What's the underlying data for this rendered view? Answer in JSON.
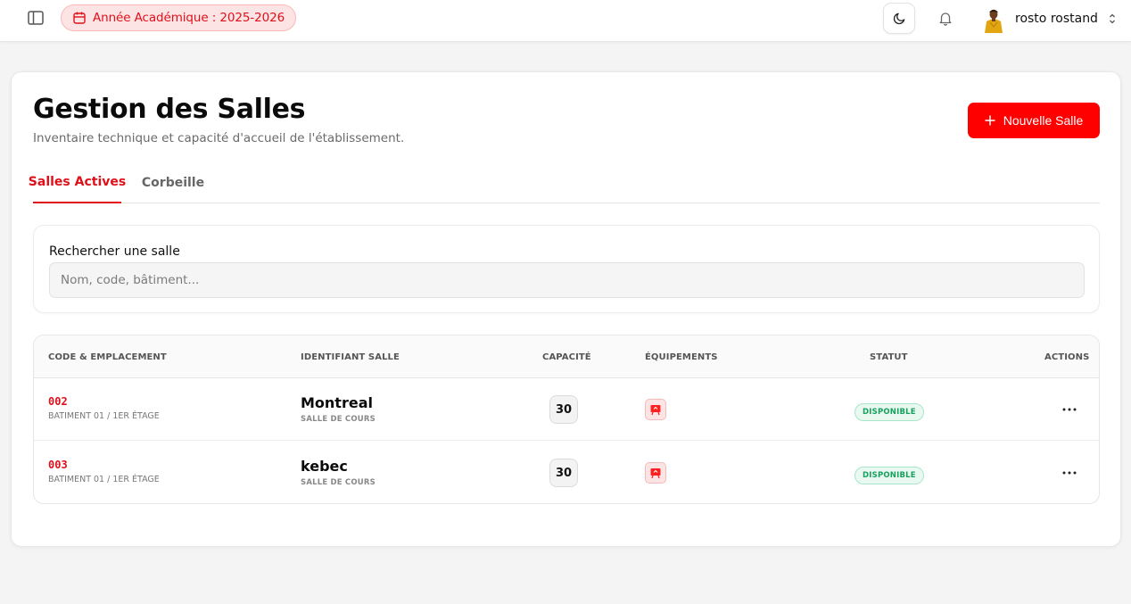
{
  "header": {
    "academic_year": "Année Académique : 2025-2026",
    "user_name": "rosto rostand"
  },
  "page": {
    "title": "Gestion des Salles",
    "subtitle": "Inventaire technique et capacité d'accueil de l'établissement.",
    "new_button": "Nouvelle Salle"
  },
  "tabs": [
    {
      "label": "Salles Actives",
      "active": true
    },
    {
      "label": "Corbeille",
      "active": false
    }
  ],
  "search": {
    "label": "Rechercher une salle",
    "value": "",
    "placeholder": "Nom, code, bâtiment..."
  },
  "table": {
    "columns": [
      "CODE & EMPLACEMENT",
      "IDENTIFIANT SALLE",
      "CAPACITÉ",
      "ÉQUIPEMENTS",
      "STATUT",
      "ACTIONS"
    ],
    "rows": [
      {
        "code": "002",
        "location": "BATIMENT 01 / 1ER ÉTAGE",
        "name": "Montreal",
        "type": "SALLE DE COURS",
        "capacity": "30",
        "equipment_icon": "projector-icon",
        "status": "DISPONIBLE"
      },
      {
        "code": "003",
        "location": "BATIMENT 01 / 1ER ÉTAGE",
        "name": "kebec",
        "type": "SALLE DE COURS",
        "capacity": "30",
        "equipment_icon": "projector-icon",
        "status": "DISPONIBLE"
      }
    ]
  },
  "colors": {
    "accent": "#ff0000",
    "accent_text": "#e0101a",
    "status_green": "#17a05d",
    "page_bg": "#f4f4f4"
  },
  "icons": {
    "sidebar_toggle": "sidebar-toggle-icon",
    "calendar": "calendar-icon",
    "theme": "moon-icon",
    "notifications": "bell-icon",
    "user_menu": "chevron-up-down-icon",
    "add": "plus-icon",
    "row_actions": "more-horizontal-icon"
  }
}
